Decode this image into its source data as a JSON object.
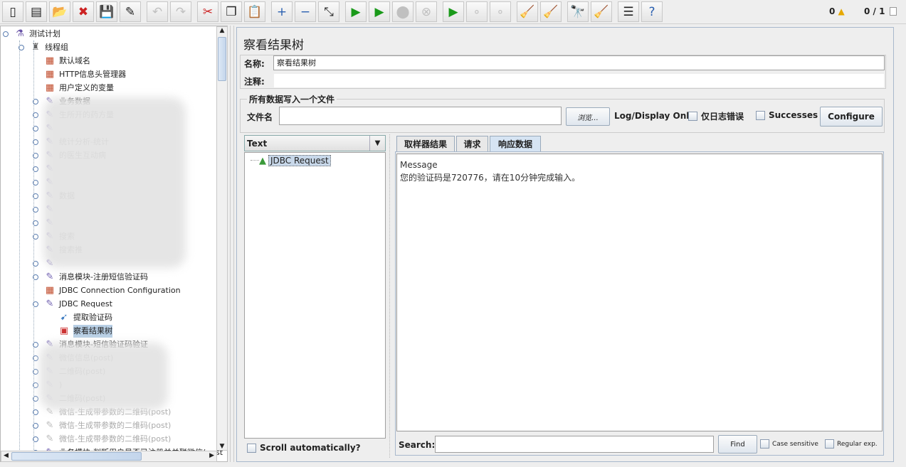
{
  "toolbar": {
    "buttons": [
      {
        "icon": "new-icon",
        "glyph": "▯",
        "enabled": true
      },
      {
        "icon": "templates-icon",
        "glyph": "▤",
        "enabled": true
      },
      {
        "icon": "open-icon",
        "glyph": "📂",
        "enabled": true
      },
      {
        "icon": "close-icon",
        "glyph": "✖",
        "enabled": true
      },
      {
        "icon": "save-icon",
        "glyph": "💾",
        "enabled": true
      },
      {
        "icon": "save-as-icon",
        "glyph": "✎",
        "enabled": true
      },
      {
        "icon": "undo-icon",
        "glyph": "↶",
        "enabled": false
      },
      {
        "icon": "redo-icon",
        "glyph": "↷",
        "enabled": false
      },
      {
        "icon": "cut-icon",
        "glyph": "✂",
        "enabled": true
      },
      {
        "icon": "copy-icon",
        "glyph": "❐",
        "enabled": true
      },
      {
        "icon": "paste-icon",
        "glyph": "📋",
        "enabled": true
      },
      {
        "icon": "expand-icon",
        "glyph": "+",
        "enabled": true
      },
      {
        "icon": "collapse-icon",
        "glyph": "−",
        "enabled": true
      },
      {
        "icon": "toggle-icon",
        "glyph": "⤡",
        "enabled": true
      },
      {
        "icon": "start-icon",
        "glyph": "▶",
        "enabled": true
      },
      {
        "icon": "start-no-pauses-icon",
        "glyph": "▶",
        "enabled": true
      },
      {
        "icon": "stop-icon",
        "glyph": "⬤",
        "enabled": false
      },
      {
        "icon": "shutdown-icon",
        "glyph": "⊗",
        "enabled": false
      },
      {
        "icon": "remote-start-all-icon",
        "glyph": "▶",
        "enabled": true
      },
      {
        "icon": "remote-stop-all-icon",
        "glyph": "∘",
        "enabled": false
      },
      {
        "icon": "remote-shutdown-all-icon",
        "glyph": "∘",
        "enabled": false
      },
      {
        "icon": "clear-icon",
        "glyph": "🧹",
        "enabled": true
      },
      {
        "icon": "clear-all-icon",
        "glyph": "🧹",
        "enabled": true
      },
      {
        "icon": "search-icon",
        "glyph": "🔭",
        "enabled": true
      },
      {
        "icon": "reset-search-icon",
        "glyph": "🧹",
        "enabled": true
      },
      {
        "icon": "function-helper-icon",
        "glyph": "☰",
        "enabled": true
      },
      {
        "icon": "help-icon",
        "glyph": "?",
        "enabled": true
      }
    ],
    "error_count": "0",
    "threads": "0 / 1"
  },
  "tree": {
    "items": [
      {
        "label": "测试计划",
        "level": 0,
        "icon": "test-plan-icon",
        "knob": true
      },
      {
        "label": "线程组",
        "level": 1,
        "icon": "thread-group-icon",
        "knob": true
      },
      {
        "label": "默认域名",
        "level": 2,
        "icon": "config-element-icon"
      },
      {
        "label": "HTTP信息头管理器",
        "level": 2,
        "icon": "config-element-icon"
      },
      {
        "label": "用户定义的变量",
        "level": 2,
        "icon": "config-element-icon"
      },
      {
        "label": "业务数据",
        "level": 2,
        "icon": "sampler-icon",
        "knob": true
      },
      {
        "label": "生所开的药方量",
        "level": 2,
        "icon": "sampler-icon",
        "knob": true
      },
      {
        "label": "",
        "level": 2,
        "icon": "sampler-icon",
        "knob": true
      },
      {
        "label": "统计分析-统计",
        "level": 2,
        "icon": "sampler-icon",
        "knob": true
      },
      {
        "label": "的医生互动病",
        "level": 2,
        "icon": "sampler-icon",
        "knob": true
      },
      {
        "label": "",
        "level": 2,
        "icon": "sampler-icon",
        "knob": true
      },
      {
        "label": "",
        "level": 2,
        "icon": "sampler-icon",
        "knob": true
      },
      {
        "label": "数据",
        "level": 2,
        "icon": "sampler-icon",
        "knob": true
      },
      {
        "label": "",
        "level": 2,
        "icon": "sampler-icon",
        "knob": true
      },
      {
        "label": "",
        "level": 2,
        "icon": "sampler-icon",
        "knob": true
      },
      {
        "label": "搜索",
        "level": 2,
        "icon": "sampler-icon",
        "knob": true
      },
      {
        "label": "搜索推",
        "level": 2,
        "icon": "sampler-icon"
      },
      {
        "label": "",
        "level": 2,
        "icon": "sampler-icon",
        "knob": true
      },
      {
        "label": "消息模块-注册短信验证码",
        "level": 2,
        "icon": "sampler-icon",
        "knob": true
      },
      {
        "label": "JDBC Connection Configuration",
        "level": 2,
        "icon": "config-element-icon"
      },
      {
        "label": "JDBC Request",
        "level": 2,
        "icon": "sampler-icon",
        "knob": true
      },
      {
        "label": "提取验证码",
        "level": 3,
        "icon": "post-processor-icon"
      },
      {
        "label": "察看结果树",
        "level": 3,
        "icon": "listener-icon",
        "selected": true
      },
      {
        "label": "消息模块-短信验证码验证",
        "level": 2,
        "icon": "sampler-icon",
        "knob": true
      },
      {
        "label": "微信信息(post)",
        "level": 2,
        "icon": "sampler-icon",
        "knob": true
      },
      {
        "label": "二维码(post)",
        "level": 2,
        "icon": "sampler-icon",
        "knob": true
      },
      {
        "label": ")",
        "level": 2,
        "icon": "sampler-icon",
        "knob": true
      },
      {
        "label": "二维码(post)",
        "level": 2,
        "icon": "sampler-icon",
        "knob": true
      },
      {
        "label": "微信-生成带参数的二维码(post)",
        "level": 2,
        "icon": "sampler-icon",
        "knob": true,
        "disabled": true
      },
      {
        "label": "微信-生成带参数的二维码(post)",
        "level": 2,
        "icon": "sampler-icon",
        "knob": true,
        "disabled": true
      },
      {
        "label": "微信-生成带参数的二维码(post)",
        "level": 2,
        "icon": "sampler-icon",
        "knob": true,
        "disabled": true
      },
      {
        "label": "业务模块-判断用户是否已注册并关联微信(post",
        "level": 2,
        "icon": "sampler-icon",
        "knob": true
      }
    ]
  },
  "panel": {
    "title": "察看结果树",
    "name_label": "名称:",
    "name_value": "察看结果树",
    "comment_label": "注释:",
    "comment_value": "",
    "file_group_title": "所有数据写入一个文件",
    "filename_label": "文件名",
    "filename_value": "",
    "browse_label": "浏览...",
    "log_display_label": "Log/Display Only:",
    "errors_only_label": "仅日志错误",
    "errors_only_checked": false,
    "successes_label": "Successes",
    "successes_checked": false,
    "configure_label": "Configure"
  },
  "results": {
    "renderer_selected": "Text",
    "items": [
      {
        "label": "JDBC Request",
        "status": "success"
      }
    ],
    "scroll_auto_label": "Scroll automatically?",
    "scroll_auto_checked": false,
    "tabs": [
      {
        "label": "取样器结果",
        "active": false
      },
      {
        "label": "请求",
        "active": false
      },
      {
        "label": "响应数据",
        "active": true
      }
    ],
    "response_lines": [
      "Message",
      "您的验证码是720776，请在10分钟完成输入。"
    ],
    "search_label": "Search:",
    "search_value": "",
    "find_label": "Find",
    "case_sensitive_label": "Case sensitive",
    "regex_label": "Regular exp."
  }
}
